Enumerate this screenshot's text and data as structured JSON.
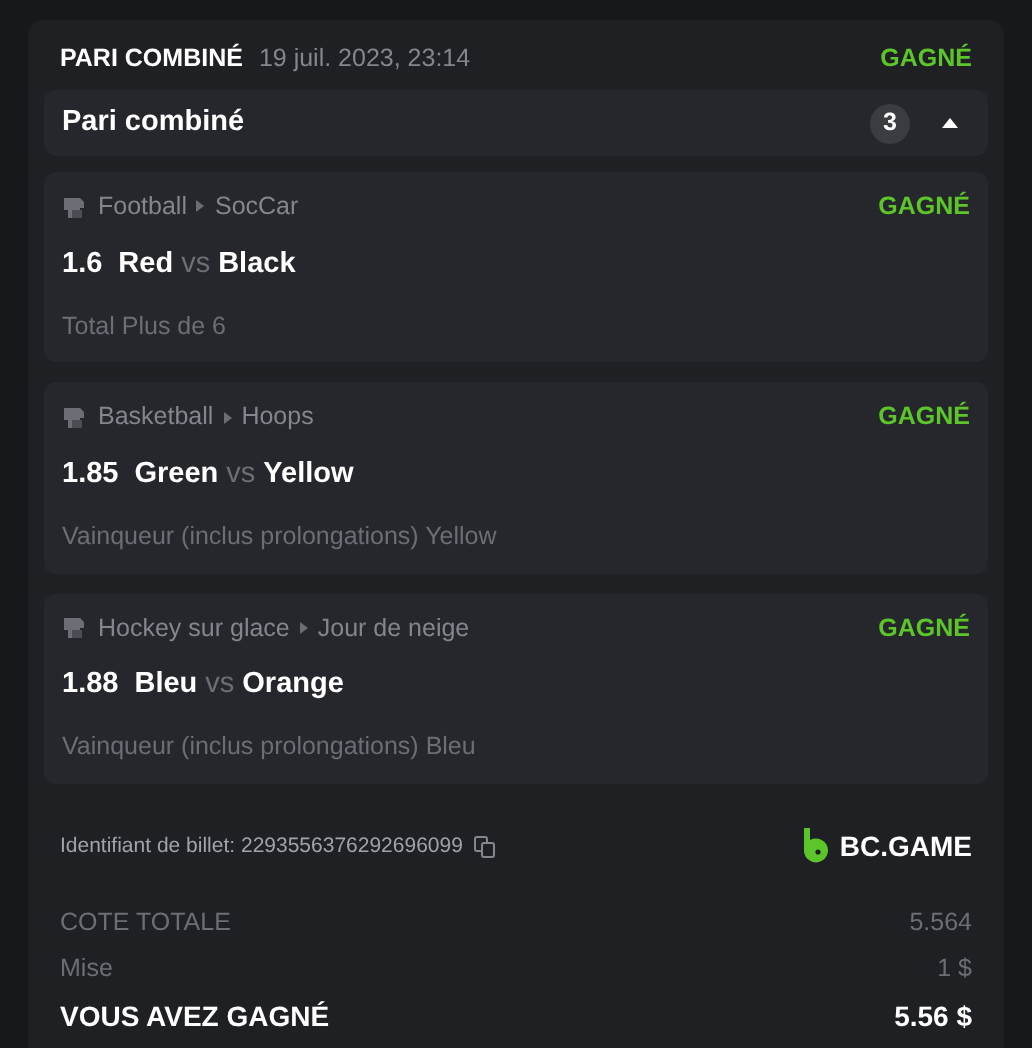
{
  "header": {
    "title": "PARI COMBINÉ",
    "date": "19 juil. 2023, 23:14",
    "status": "GAGNÉ"
  },
  "group": {
    "title": "Pari combiné",
    "count": "3",
    "expanded": true
  },
  "legs": [
    {
      "sport": "Football",
      "league": "SocCar",
      "status": "GAGNÉ",
      "odds": "1.6",
      "home": "Red",
      "vs": "vs",
      "away": "Black",
      "market": "Total Plus de 6"
    },
    {
      "sport": "Basketball",
      "league": "Hoops",
      "status": "GAGNÉ",
      "odds": "1.85",
      "home": "Green",
      "vs": "vs",
      "away": "Yellow",
      "market": "Vainqueur (inclus prolongations) Yellow"
    },
    {
      "sport": "Hockey sur glace",
      "league": "Jour de neige",
      "status": "GAGNÉ",
      "odds": "1.88",
      "home": "Bleu",
      "vs": "vs",
      "away": "Orange",
      "market": "Vainqueur (inclus prolongations) Bleu"
    }
  ],
  "ticket": {
    "label": "Identifiant de billet: 2293556376292696099",
    "brand": "BC.GAME"
  },
  "totals": [
    {
      "kind": "muted",
      "label": "COTE TOTALE",
      "value": "5.564"
    },
    {
      "kind": "muted",
      "label": "Mise",
      "value": "1 $"
    },
    {
      "kind": "strong",
      "label": "VOUS AVEZ GAGNÉ",
      "value": "5.56 $"
    }
  ]
}
